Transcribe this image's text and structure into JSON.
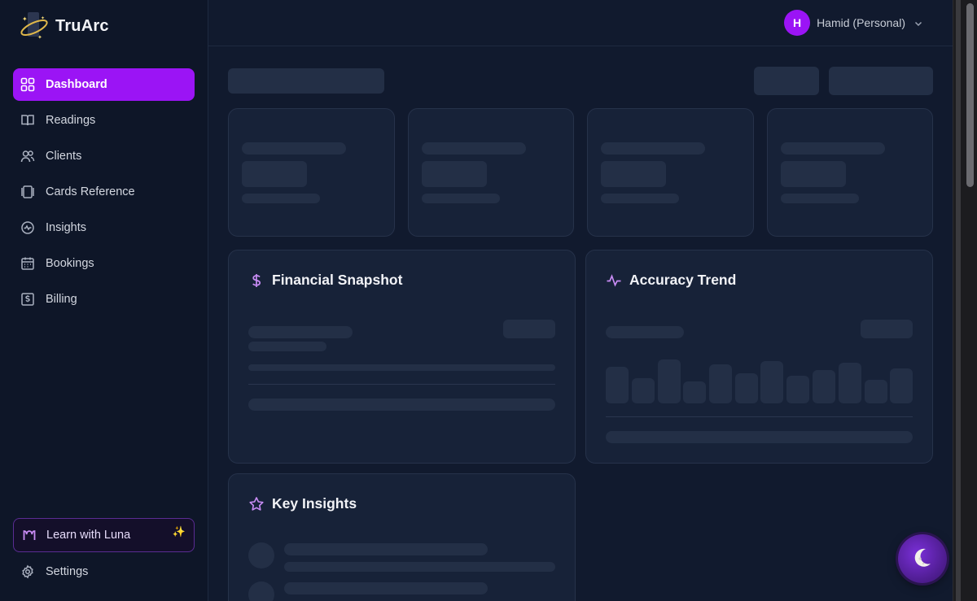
{
  "brand": {
    "name": "TruArc"
  },
  "sidebar": {
    "items": [
      {
        "label": "Dashboard",
        "icon": "grid-icon",
        "active": true
      },
      {
        "label": "Readings",
        "icon": "book-icon"
      },
      {
        "label": "Clients",
        "icon": "users-icon"
      },
      {
        "label": "Cards Reference",
        "icon": "cards-icon"
      },
      {
        "label": "Insights",
        "icon": "pulse-circle-icon"
      },
      {
        "label": "Bookings",
        "icon": "calendar-icon"
      },
      {
        "label": "Billing",
        "icon": "dollar-card-icon"
      }
    ],
    "learn_label": "Learn with Luna",
    "settings_label": "Settings"
  },
  "header": {
    "avatar_initial": "H",
    "account_name": "Hamid (Personal)"
  },
  "cards": {
    "financial_title": "Financial Snapshot",
    "accuracy_title": "Accuracy Trend",
    "insights_title": "Key Insights"
  },
  "colors": {
    "accent": "#9b14f5",
    "sidebar_bg": "#0e1628",
    "page_bg": "#111a2e",
    "skeleton": "#232f46"
  }
}
